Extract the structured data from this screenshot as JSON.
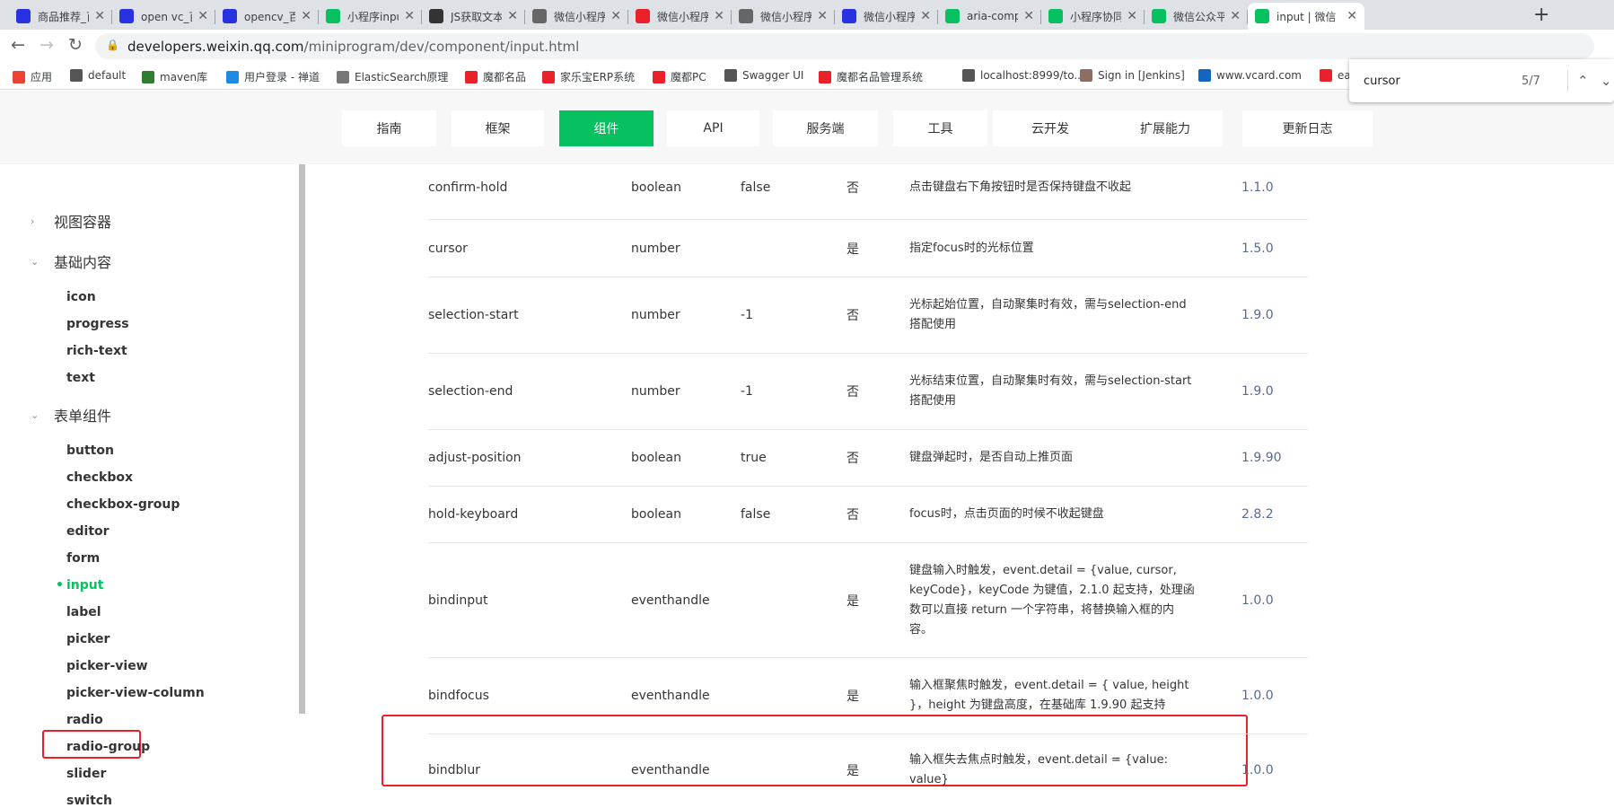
{
  "tabs": [
    {
      "title": "商品推荐_百",
      "favicon": "paw",
      "color": "#2932e1"
    },
    {
      "title": "open vc_百",
      "favicon": "paw",
      "color": "#2932e1"
    },
    {
      "title": "opencv_百",
      "favicon": "paw",
      "color": "#2932e1"
    },
    {
      "title": "小程序inpu",
      "favicon": "wechat",
      "color": "#07c160"
    },
    {
      "title": "JS获取文本",
      "favicon": "51",
      "color": "#333333"
    },
    {
      "title": "微信小程序",
      "favicon": "bird",
      "color": "#666666"
    },
    {
      "title": "微信小程序",
      "favicon": "c",
      "color": "#e8212a"
    },
    {
      "title": "微信小程序",
      "favicon": "bird",
      "color": "#666666"
    },
    {
      "title": "微信小程序",
      "favicon": "paw",
      "color": "#2932e1"
    },
    {
      "title": "aria-compo",
      "favicon": "wechat",
      "color": "#07c160"
    },
    {
      "title": "小程序协同",
      "favicon": "wechat",
      "color": "#07c160"
    },
    {
      "title": "微信公众平",
      "favicon": "wechat",
      "color": "#07c160"
    },
    {
      "title": "input | 微信",
      "favicon": "wechat",
      "color": "#07c160",
      "active": true
    }
  ],
  "address": {
    "host": "developers.weixin.qq.com",
    "path": "/miniprogram/dev/component/input.html"
  },
  "bookmarks": [
    {
      "label": "应用",
      "color": "#ea4335"
    },
    {
      "label": "default",
      "color": "#555555"
    },
    {
      "label": "maven库",
      "color": "#2e7d32"
    },
    {
      "label": "用户登录 - 禅道",
      "color": "#1e88e5"
    },
    {
      "label": "ElasticSearch原理",
      "color": "#777777"
    },
    {
      "label": "魔都名品",
      "color": "#e8212a"
    },
    {
      "label": "家乐宝ERP系统",
      "color": "#e8212a"
    },
    {
      "label": "魔都PC",
      "color": "#e8212a"
    },
    {
      "label": "Swagger UI",
      "color": "#555555"
    },
    {
      "label": "魔都名品管理系统",
      "color": "#e8212a"
    },
    {
      "label": "localhost:8999/to...",
      "color": "#555555"
    },
    {
      "label": "Sign in [Jenkins]",
      "color": "#8d6e63"
    },
    {
      "label": "www.vcard.com",
      "color": "#1565c0"
    },
    {
      "label": "ea",
      "color": "#e8212a"
    }
  ],
  "find": {
    "query": "cursor",
    "count": "5/7"
  },
  "site_nav": [
    {
      "label": "指南"
    },
    {
      "label": "框架"
    },
    {
      "label": "组件",
      "active": true
    },
    {
      "label": "API"
    },
    {
      "label": "服务端"
    },
    {
      "label": "工具"
    },
    {
      "label": "云开发"
    },
    {
      "label": "扩展能力"
    },
    {
      "label": "更新日志"
    }
  ],
  "sidebar": {
    "groups": [
      {
        "label": "视图容器",
        "expanded": false
      },
      {
        "label": "基础内容",
        "expanded": true,
        "items": [
          "icon",
          "progress",
          "rich-text",
          "text"
        ]
      },
      {
        "label": "表单组件",
        "expanded": true,
        "items": [
          "button",
          "checkbox",
          "checkbox-group",
          "editor",
          "form",
          "input",
          "label",
          "picker",
          "picker-view",
          "picker-view-column",
          "radio",
          "radio-group",
          "slider",
          "switch"
        ]
      }
    ],
    "current": "input"
  },
  "table_rows": [
    {
      "name": "confirm-hold",
      "type": "boolean",
      "default": "false",
      "required": "否",
      "desc": "点击键盘右下角按钮时是否保持键盘不收起",
      "version": "1.1.0"
    },
    {
      "name": "cursor",
      "type": "number",
      "default": "",
      "required": "是",
      "desc": "指定focus时的光标位置",
      "version": "1.5.0"
    },
    {
      "name": "selection-start",
      "type": "number",
      "default": "-1",
      "required": "否",
      "desc": "光标起始位置，自动聚集时有效，需与selection-end搭配使用",
      "version": "1.9.0"
    },
    {
      "name": "selection-end",
      "type": "number",
      "default": "-1",
      "required": "否",
      "desc": "光标结束位置，自动聚集时有效，需与selection-start搭配使用",
      "version": "1.9.0"
    },
    {
      "name": "adjust-position",
      "type": "boolean",
      "default": "true",
      "required": "否",
      "desc": "键盘弹起时，是否自动上推页面",
      "version": "1.9.90"
    },
    {
      "name": "hold-keyboard",
      "type": "boolean",
      "default": "false",
      "required": "否",
      "desc": "focus时，点击页面的时候不收起键盘",
      "version": "2.8.2"
    },
    {
      "name": "bindinput",
      "type": "eventhandle",
      "default": "",
      "required": "是",
      "desc": "键盘输入时触发，event.detail = {value, cursor, keyCode}，keyCode 为键值，2.1.0 起支持，处理函数可以直接 return 一个字符串，将替换输入框的内容。",
      "version": "1.0.0"
    },
    {
      "name": "bindfocus",
      "type": "eventhandle",
      "default": "",
      "required": "是",
      "desc": "输入框聚焦时触发，event.detail = { value, height }，height 为键盘高度，在基础库 1.9.90 起支持",
      "version": "1.0.0"
    },
    {
      "name": "bindblur",
      "type": "eventhandle",
      "default": "",
      "required": "是",
      "desc": "输入框失去焦点时触发，event.detail = {value: value}",
      "version": "1.0.0"
    }
  ],
  "colors": {
    "accent": "#07c160",
    "highlight": "#e8212a",
    "version_link": "#576b95"
  }
}
